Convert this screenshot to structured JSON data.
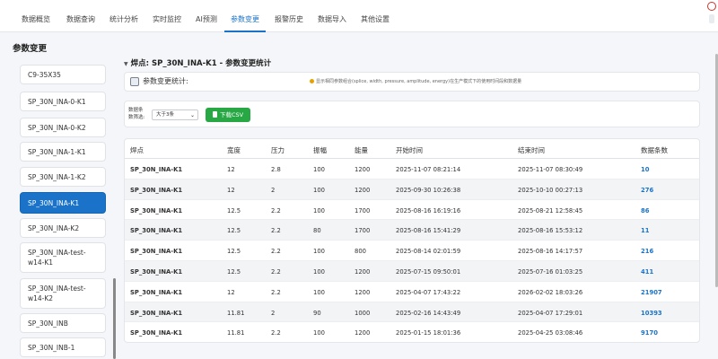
{
  "nav": {
    "tabs": [
      {
        "label": "数据概览",
        "active": false
      },
      {
        "label": "数据查询",
        "active": false
      },
      {
        "label": "统计分析",
        "active": false
      },
      {
        "label": "实时监控",
        "active": false
      },
      {
        "label": "AI预测",
        "active": false
      },
      {
        "label": "参数变更",
        "active": true
      },
      {
        "label": "报警历史",
        "active": false
      },
      {
        "label": "数据导入",
        "active": false
      },
      {
        "label": "其他设置",
        "active": false
      }
    ]
  },
  "page": {
    "title": "参数变更"
  },
  "sidebar": {
    "items": [
      {
        "label": "C9-35X35",
        "active": false
      },
      {
        "label": "SP_30N_INA-0-K1",
        "active": false
      },
      {
        "label": "SP_30N_INA-0-K2",
        "active": false
      },
      {
        "label": "SP_30N_INA-1-K1",
        "active": false
      },
      {
        "label": "SP_30N_INA-1-K2",
        "active": false
      },
      {
        "label": "SP_30N_INA-K1",
        "active": true
      },
      {
        "label": "SP_30N_INA-K2",
        "active": false
      },
      {
        "label": "SP_30N_INA-test-w14-K1",
        "active": false
      },
      {
        "label": "SP_30N_INA-test-w14-K2",
        "active": false
      },
      {
        "label": "SP_30N_INB",
        "active": false
      },
      {
        "label": "SP_30N_INB-1",
        "active": false
      }
    ]
  },
  "main": {
    "title": "焊点: SP_30N_INA-K1 - 参数变更统计",
    "info_label": "参数变更统计:",
    "info_desc": "显示相同参数组合(splice, width, pressure, amplitude, energy)在生产模式下的使用时间段和数据量",
    "filter_label": "数据条数筛选:",
    "filter_value": "大于3条",
    "csv_label": "下载CSV"
  },
  "table": {
    "headers": [
      "焊点",
      "宽度",
      "压力",
      "振幅",
      "能量",
      "开始时间",
      "结束时间",
      "数据条数"
    ],
    "rows": [
      [
        "SP_30N_INA-K1",
        "12",
        "2.8",
        "100",
        "1200",
        "2025-11-07 08:21:14",
        "2025-11-07 08:30:49",
        "10"
      ],
      [
        "SP_30N_INA-K1",
        "12",
        "2",
        "100",
        "1200",
        "2025-09-30 10:26:38",
        "2025-10-10 00:27:13",
        "276"
      ],
      [
        "SP_30N_INA-K1",
        "12.5",
        "2.2",
        "100",
        "1700",
        "2025-08-16 16:19:16",
        "2025-08-21 12:58:45",
        "86"
      ],
      [
        "SP_30N_INA-K1",
        "12.5",
        "2.2",
        "80",
        "1700",
        "2025-08-16 15:41:29",
        "2025-08-16 15:53:12",
        "11"
      ],
      [
        "SP_30N_INA-K1",
        "12.5",
        "2.2",
        "100",
        "800",
        "2025-08-14 02:01:59",
        "2025-08-16 14:17:57",
        "216"
      ],
      [
        "SP_30N_INA-K1",
        "12.5",
        "2.2",
        "100",
        "1200",
        "2025-07-15 09:50:01",
        "2025-07-16 01:03:25",
        "411"
      ],
      [
        "SP_30N_INA-K1",
        "12",
        "2.2",
        "100",
        "1200",
        "2025-04-07 17:43:22",
        "2026-02-02 18:03:26",
        "21907"
      ],
      [
        "SP_30N_INA-K1",
        "11.81",
        "2",
        "90",
        "1000",
        "2025-02-16 14:43:49",
        "2025-04-07 17:29:01",
        "10393"
      ],
      [
        "SP_30N_INA-K1",
        "11.81",
        "2.2",
        "100",
        "1200",
        "2025-01-15 18:01:36",
        "2025-04-25 03:08:46",
        "9170"
      ]
    ]
  }
}
